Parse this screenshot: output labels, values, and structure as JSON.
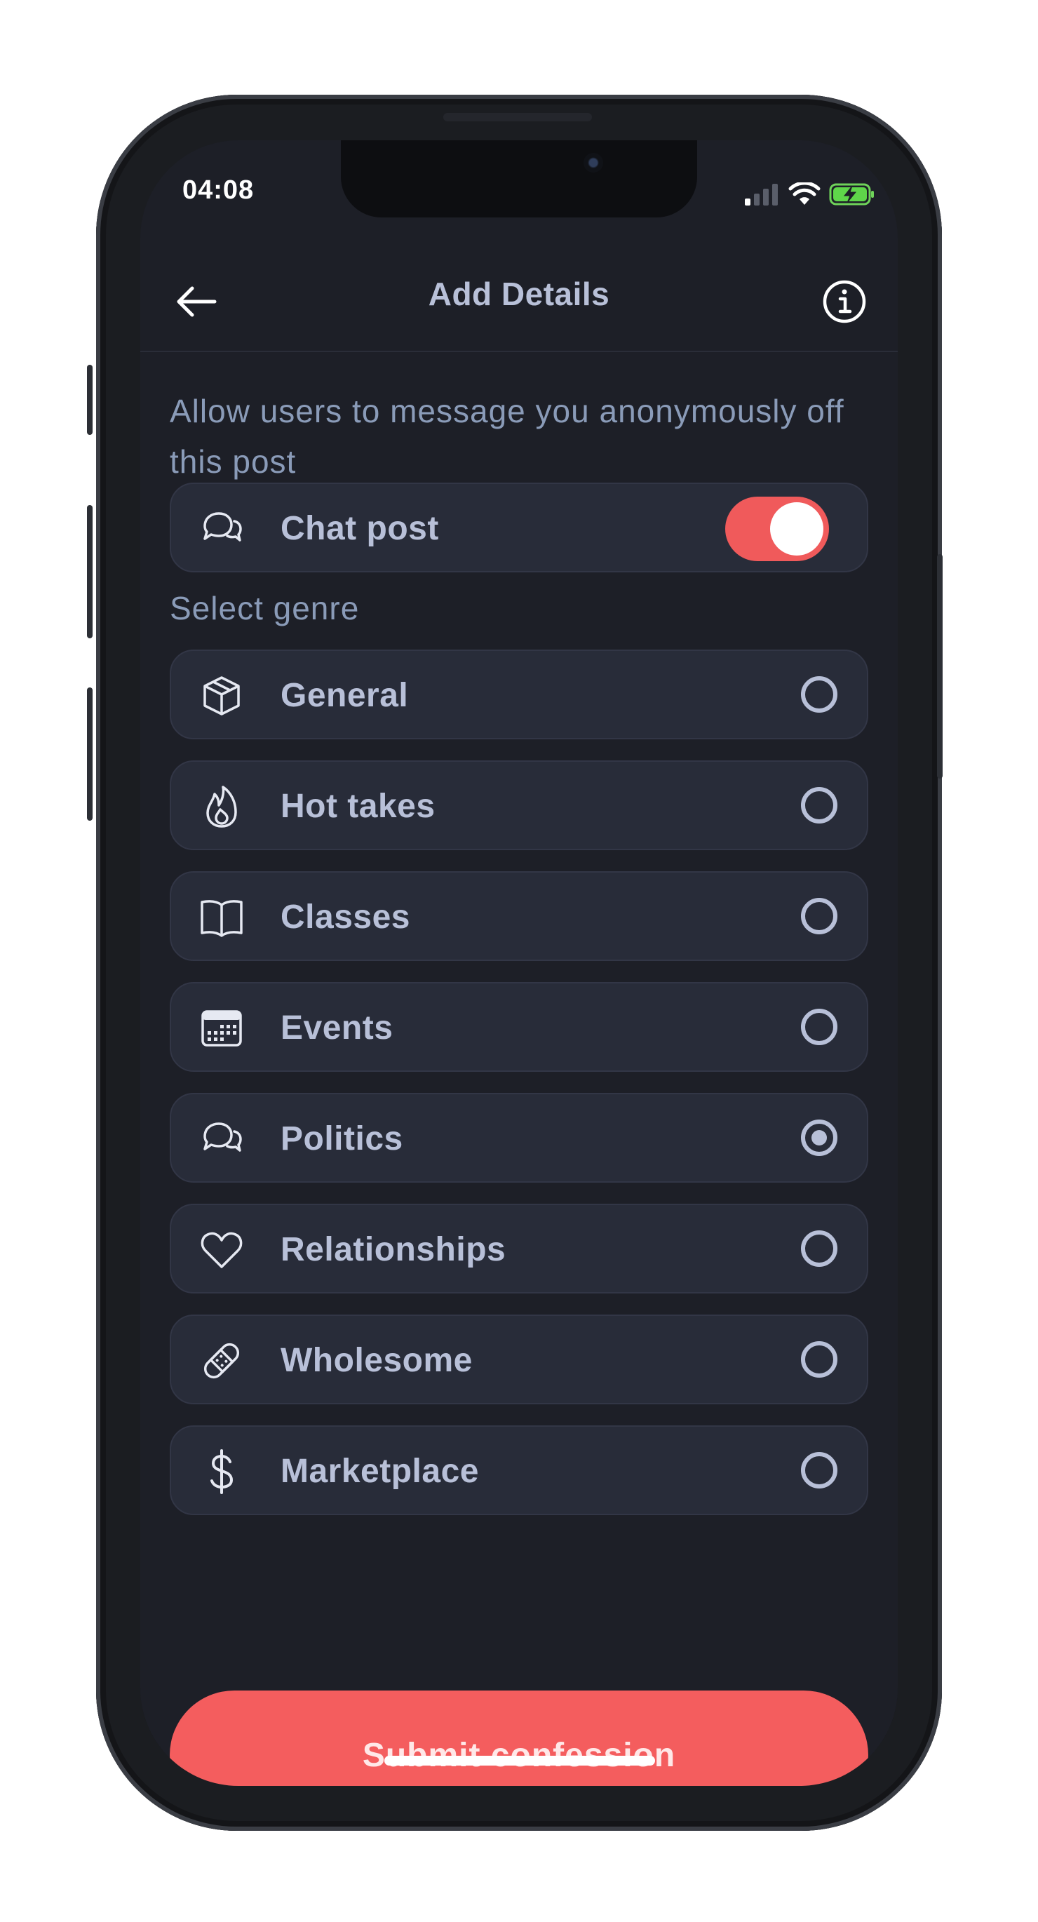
{
  "status_bar": {
    "time": "04:08",
    "icons": [
      "cellular-signal-icon",
      "wifi-icon",
      "battery-charging-icon"
    ]
  },
  "header": {
    "title": "Add Details",
    "back_icon": "arrow-left-icon",
    "info_icon": "info-circle-icon"
  },
  "chat": {
    "description": "Allow users to message you anonymously off this post",
    "label": "Chat post",
    "icon": "chat-bubbles-icon",
    "enabled": true
  },
  "genre": {
    "section_label": "Select genre",
    "selected": "Politics",
    "options": [
      {
        "label": "General",
        "icon": "cube-icon",
        "selected": false
      },
      {
        "label": "Hot takes",
        "icon": "flame-icon",
        "selected": false
      },
      {
        "label": "Classes",
        "icon": "book-icon",
        "selected": false
      },
      {
        "label": "Events",
        "icon": "calendar-icon",
        "selected": false
      },
      {
        "label": "Politics",
        "icon": "chat-bubbles-icon",
        "selected": true
      },
      {
        "label": "Relationships",
        "icon": "heart-icon",
        "selected": false
      },
      {
        "label": "Wholesome",
        "icon": "bandage-icon",
        "selected": false
      },
      {
        "label": "Marketplace",
        "icon": "dollar-icon",
        "selected": false
      }
    ]
  },
  "submit": {
    "label": "Submit confession"
  },
  "colors": {
    "background": "#1d1f27",
    "card": "#282c39",
    "accent": "#f45d5e",
    "text_primary": "#b8c0d8",
    "text_secondary": "#8a9bb8"
  }
}
